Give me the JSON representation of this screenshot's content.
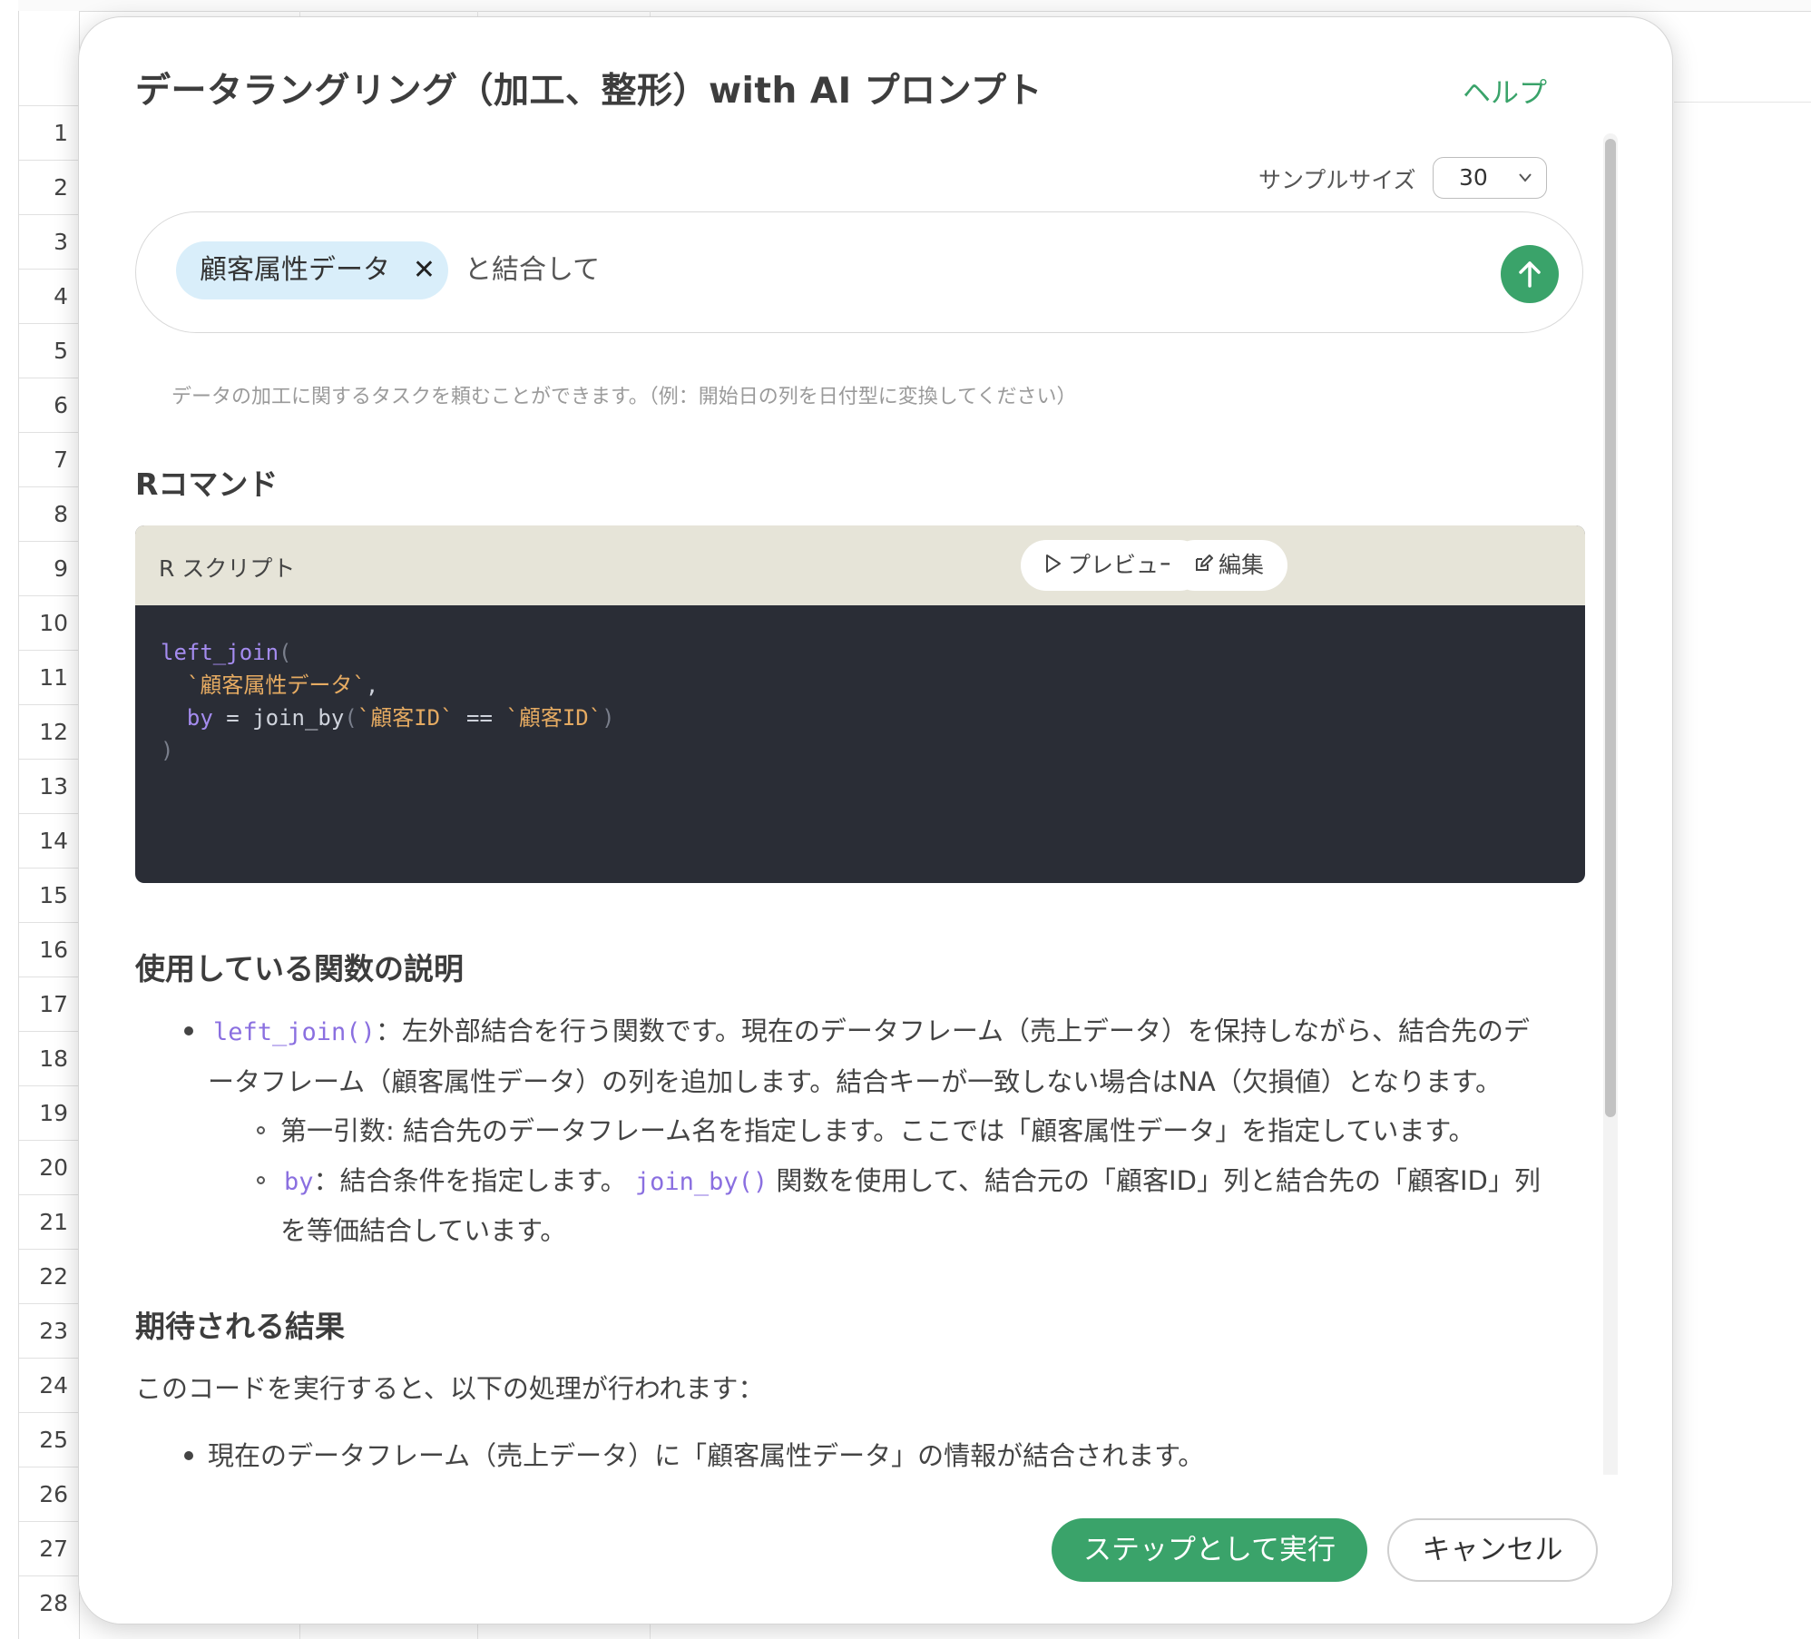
{
  "sheet": {
    "row_numbers": [
      "1",
      "2",
      "3",
      "4",
      "5",
      "6",
      "7",
      "8",
      "9",
      "10",
      "11",
      "12",
      "13",
      "14",
      "15",
      "16",
      "17",
      "18",
      "19",
      "20",
      "21",
      "22",
      "23",
      "24",
      "25",
      "26",
      "27",
      "28"
    ]
  },
  "dialog": {
    "title": "データラングリング（加工、整形）with AI プロンプト",
    "help_label": "ヘルプ",
    "sample_size_label": "サンプルサイズ",
    "sample_size_value": "30",
    "prompt": {
      "chip_label": "顧客属性データ",
      "text": "と結合して"
    },
    "hint": "データの加工に関するタスクを頼むことができます。（例：開始日の列を日付型に変換してください）",
    "r_command_heading": "Rコマンド",
    "code_panel": {
      "label": "R スクリプト",
      "preview_label": "プレビュー",
      "edit_label": "編集"
    },
    "code": {
      "line1_fn": "left_join",
      "line1_paren": "(",
      "line2_str": "`顧客属性データ`",
      "line2_comma": ",",
      "line3_arg": "by",
      "line3_eq": " = ",
      "line3_fn": "join_by",
      "line3_open": "(",
      "line3_str1": "`顧客ID`",
      "line3_op": " == ",
      "line3_str2": "`顧客ID`",
      "line3_close": ")",
      "line4_close": ")"
    },
    "functions_heading": "使用している関数の説明",
    "func_item1_code": "left_join()",
    "func_item1_text_a": "：左外部結合を行う関数です。現在のデータフレーム（売上データ）を保持しながら、結合先のデ",
    "func_item1_text_b": "ータフレーム（顧客属性データ）の列を追加します。結合キーが一致しない場合はNA（欠損値）となります。",
    "func_sub1_text": "第一引数: 結合先のデータフレーム名を指定します。ここでは「顧客属性データ」を指定しています。",
    "func_sub2_code1": "by",
    "func_sub2_text_a": "：結合条件を指定します。",
    "func_sub2_code2": "join_by()",
    "func_sub2_text_b": "関数を使用して、結合元の「顧客ID」列と結合先の「顧客ID」列",
    "func_sub2_text_c": "を等価結合しています。",
    "result_heading": "期待される結果",
    "result_intro": "このコードを実行すると、以下の処理が行われます：",
    "result_item1": "現在のデータフレーム（売上データ）に「顧客属性データ」の情報が結合されます。",
    "run_button": "ステップとして実行",
    "cancel_button": "キャンセル"
  },
  "colors": {
    "accent": "#3aa36a",
    "chip_bg": "#d9eefa",
    "code_bg": "#2a2d36",
    "code_header_bg": "#e6e4d8"
  },
  "icons": {
    "send": "arrow-up-icon",
    "preview": "play-outline-icon",
    "edit": "edit-icon",
    "chip_remove": "close-icon",
    "select": "chevron-down-icon"
  }
}
